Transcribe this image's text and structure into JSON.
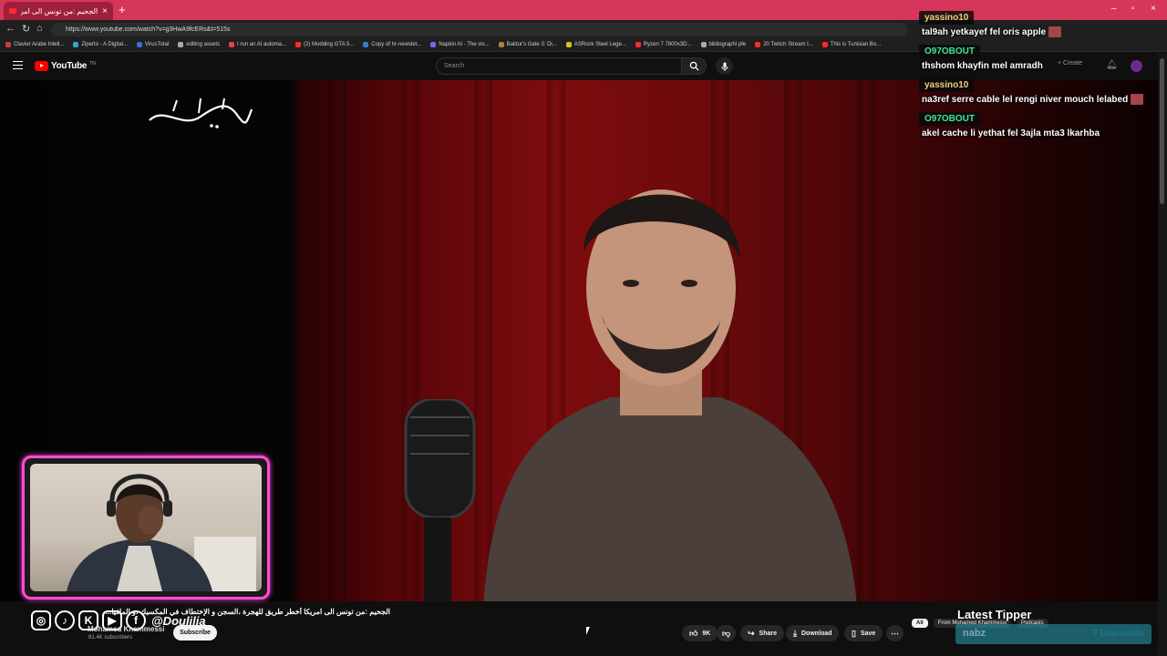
{
  "browser": {
    "tab_title": "الجحيم :من تونس الى امريكا أخطر طريق",
    "url": "https://www.youtube.com/watch?v=g3HwA9fcERs&t=515s",
    "bookmarks": [
      {
        "label": "Clavier Arabe Intell...",
        "color": "#d13a3a"
      },
      {
        "label": "Ziperto - A Digital...",
        "color": "#3aa0d1"
      },
      {
        "label": "VirusTotal",
        "color": "#3a6fd1"
      },
      {
        "label": "editing assets",
        "color": "#aaaaaa"
      },
      {
        "label": "I run an AI automa...",
        "color": "#e0483e"
      },
      {
        "label": "(2) Modding GTA 5...",
        "color": "#ff2b2b"
      },
      {
        "label": "Copy of hr-newslet...",
        "color": "#3a7bd1"
      },
      {
        "label": "Napkin AI - The vis...",
        "color": "#8b5cf6"
      },
      {
        "label": "Baldur's Gate 3: Di...",
        "color": "#b08040"
      },
      {
        "label": "ASRock Steel Lege...",
        "color": "#e0c020"
      },
      {
        "label": "Ryzen 7 7800x3D...",
        "color": "#ff2b2b"
      },
      {
        "label": "bibliographi pfe",
        "color": "#aaaaaa"
      },
      {
        "label": "20 Twitch Stream I...",
        "color": "#ff2b2b"
      },
      {
        "label": "This is Tunisian Bo...",
        "color": "#ff2b2b"
      }
    ]
  },
  "youtube": {
    "logo_text": "YouTube",
    "logo_sup": "TN",
    "search_placeholder": "Search",
    "create_label": "+ Create"
  },
  "chat": [
    {
      "user": "yassino10",
      "user_color": "gold",
      "text": "tal9ah yetkayef fel oris apple",
      "emote": true
    },
    {
      "user": "O97OBOUT",
      "user_color": "green",
      "text": "thshom khayfin mel amradh",
      "emote": false
    },
    {
      "user": "yassino10",
      "user_color": "gold",
      "text": "na3ref serre cable lel rengi niver mouch lelabed",
      "emote": true
    },
    {
      "user": "O97OBOUT",
      "user_color": "green",
      "text": "akel cache li yethat fel 3ajla mta3 lkarhba",
      "emote": false
    }
  ],
  "overlay": {
    "social_handle": "@Doulilia",
    "latest_tipper_label": "Latest Tipper",
    "tipper_name": "nabz",
    "tipper_amount": "7 Diamonds"
  },
  "video": {
    "title": "الجحيم :من تونس الى امريكا أخطر طريق للهجرة ،السجن و الإختطاف في المكسيك ،و المافيا...",
    "channel": "Mohamed Khammessi",
    "subscribers": "81.4K subscribers",
    "subscribe_label": "Subscribe",
    "likes": "9K",
    "share_label": "Share",
    "download_label": "Download",
    "save_label": "Save"
  },
  "chips": [
    "All",
    "From Mohamed Khammessi",
    "Podcasts"
  ]
}
